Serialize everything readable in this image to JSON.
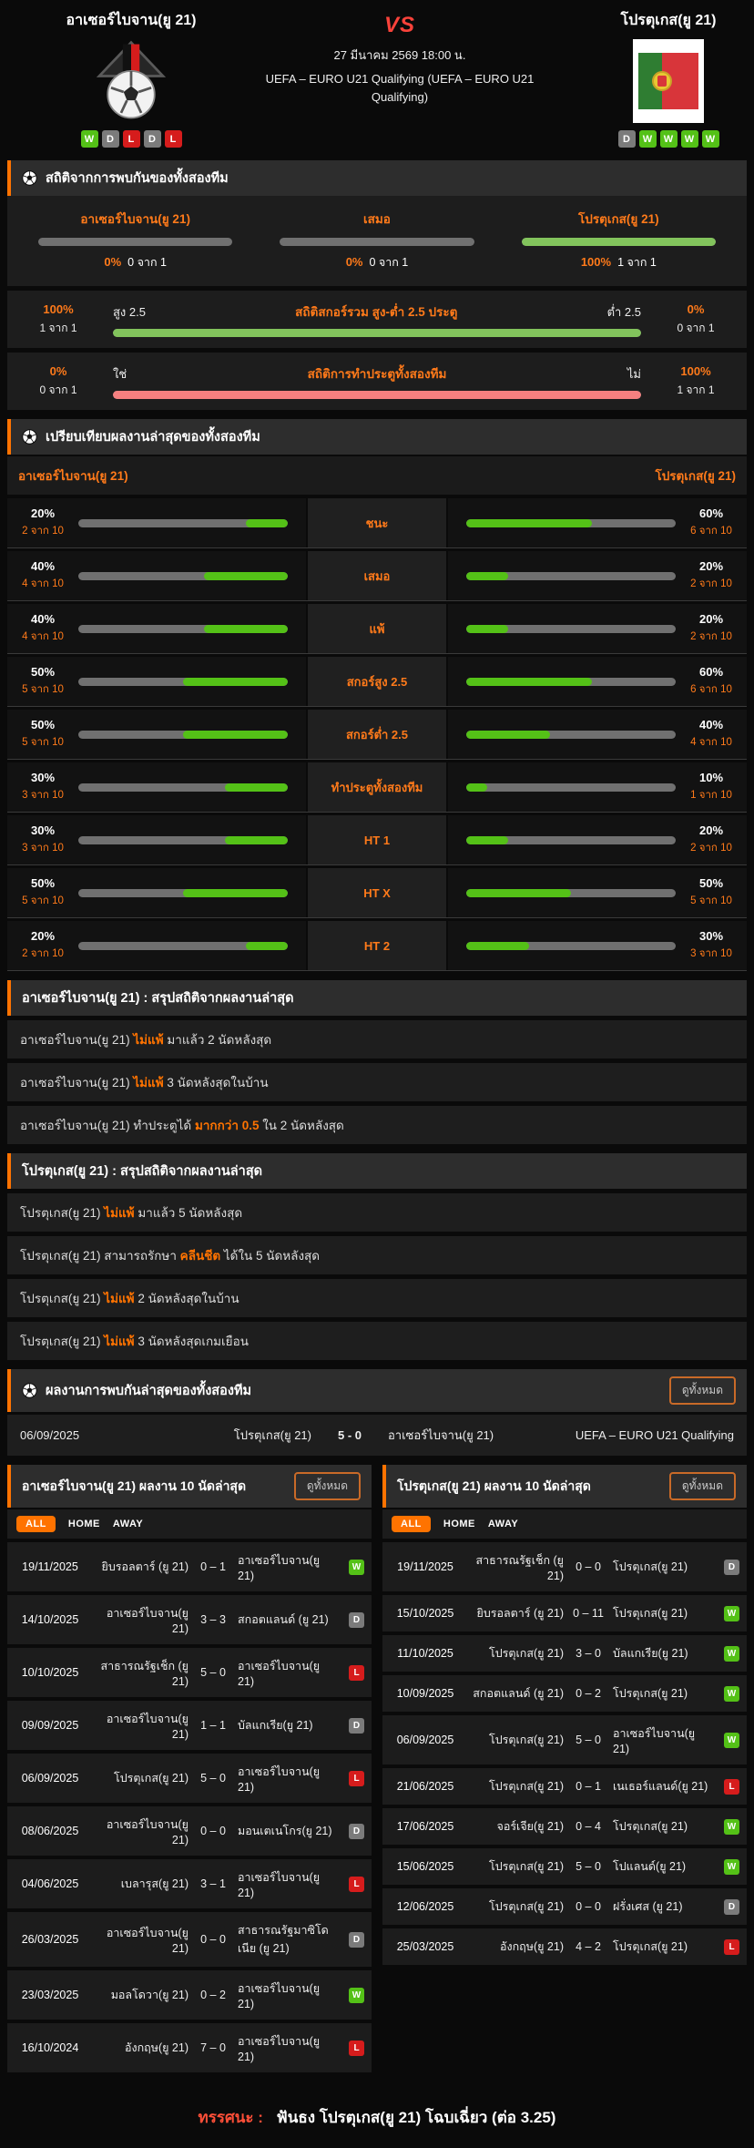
{
  "header": {
    "home": {
      "name": "อาเซอร์ไบจาน(ยู 21)",
      "form": [
        "W",
        "D",
        "L",
        "D",
        "L"
      ]
    },
    "away": {
      "name": "โปรตุเกส(ยู 21)",
      "form": [
        "D",
        "W",
        "W",
        "W",
        "W"
      ]
    },
    "vs": "VS",
    "datetime": "27 มีนาคม 2569 18:00 น.",
    "competition": "UEFA – EURO U21 Qualifying (UEFA – EURO U21 Qualifying)"
  },
  "h2h_stats": {
    "title": "สถิติจากการพบกันของทั้งสองทีม",
    "result_cols": [
      {
        "label": "อาเซอร์ไบจาน(ยู 21)",
        "pct": "0%",
        "count": "0 จาก 1",
        "fill": 0,
        "color": "green-soft"
      },
      {
        "label": "เสมอ",
        "pct": "0%",
        "count": "0 จาก 1",
        "fill": 0,
        "color": "green-soft"
      },
      {
        "label": "โปรตุเกส(ยู 21)",
        "pct": "100%",
        "count": "1 จาก 1",
        "fill": 100,
        "color": "green-soft"
      }
    ],
    "lines": [
      {
        "left_pct": "100%",
        "left_count": "1 จาก 1",
        "left_label": "สูง 2.5",
        "title": "สถิติสกอร์รวม สูง-ต่ำ 2.5 ประตู",
        "right_label": "ต่ำ 2.5",
        "right_pct": "0%",
        "right_count": "0 จาก 1",
        "fill": 100,
        "color": "green-soft"
      },
      {
        "left_pct": "0%",
        "left_count": "0 จาก 1",
        "left_label": "ใช่",
        "title": "สถิติการทำประตูทั้งสองทีม",
        "right_label": "ไม่",
        "right_pct": "100%",
        "right_count": "1 จาก 1",
        "fill": 100,
        "color": "pink"
      }
    ]
  },
  "comparison": {
    "title": "เปรียบเทียบผลงานล่าสุดของทั้งสองทีม",
    "home_team": "อาเซอร์ไบจาน(ยู 21)",
    "away_team": "โปรตุเกส(ยู 21)",
    "rows": [
      {
        "label": "ชนะ",
        "home_pct": 20,
        "home_count": "2 จาก 10",
        "away_pct": 60,
        "away_count": "6 จาก 10"
      },
      {
        "label": "เสมอ",
        "home_pct": 40,
        "home_count": "4 จาก 10",
        "away_pct": 20,
        "away_count": "2 จาก 10"
      },
      {
        "label": "แพ้",
        "home_pct": 40,
        "home_count": "4 จาก 10",
        "away_pct": 20,
        "away_count": "2 จาก 10"
      },
      {
        "label": "สกอร์สูง 2.5",
        "home_pct": 50,
        "home_count": "5 จาก 10",
        "away_pct": 60,
        "away_count": "6 จาก 10"
      },
      {
        "label": "สกอร์ต่ำ 2.5",
        "home_pct": 50,
        "home_count": "5 จาก 10",
        "away_pct": 40,
        "away_count": "4 จาก 10"
      },
      {
        "label": "ทำประตูทั้งสองทีม",
        "home_pct": 30,
        "home_count": "3 จาก 10",
        "away_pct": 10,
        "away_count": "1 จาก 10"
      },
      {
        "label": "HT 1",
        "home_pct": 30,
        "home_count": "3 จาก 10",
        "away_pct": 20,
        "away_count": "2 จาก 10"
      },
      {
        "label": "HT X",
        "home_pct": 50,
        "home_count": "5 จาก 10",
        "away_pct": 50,
        "away_count": "5 จาก 10"
      },
      {
        "label": "HT 2",
        "home_pct": 20,
        "home_count": "2 จาก 10",
        "away_pct": 30,
        "away_count": "3 จาก 10"
      }
    ]
  },
  "summaries": [
    {
      "title": "อาเซอร์ไบจาน(ยู 21) : สรุปสถิติจากผลงานล่าสุด",
      "rows": [
        {
          "pre": "อาเซอร์ไบจาน(ยู 21) ",
          "highlight": "ไม่แพ้",
          "post": " มาแล้ว 2 นัดหลังสุด"
        },
        {
          "pre": "อาเซอร์ไบจาน(ยู 21) ",
          "highlight": "ไม่แพ้",
          "post": " 3 นัดหลังสุดในบ้าน"
        },
        {
          "pre": "อาเซอร์ไบจาน(ยู 21) ทำประตูได้ ",
          "highlight": "มากกว่า 0.5",
          "post": " ใน 2 นัดหลังสุด"
        }
      ]
    },
    {
      "title": "โปรตุเกส(ยู 21) : สรุปสถิติจากผลงานล่าสุด",
      "rows": [
        {
          "pre": "โปรตุเกส(ยู 21) ",
          "highlight": "ไม่แพ้",
          "post": " มาแล้ว 5 นัดหลังสุด"
        },
        {
          "pre": "โปรตุเกส(ยู 21) สามารถรักษา ",
          "highlight": "คลีนชีต",
          "post": " ได้ใน 5 นัดหลังสุด"
        },
        {
          "pre": "โปรตุเกส(ยู 21) ",
          "highlight": "ไม่แพ้",
          "post": " 2 นัดหลังสุดในบ้าน"
        },
        {
          "pre": "โปรตุเกส(ยู 21) ",
          "highlight": "ไม่แพ้",
          "post": " 3 นัดหลังสุดเกมเยือน"
        }
      ]
    }
  ],
  "h2h_results": {
    "title": "ผลงานการพบกันล่าสุดของทั้งสองทีม",
    "view_all": "ดูทั้งหมด",
    "rows": [
      {
        "date": "06/09/2025",
        "home": "โปรตุเกส(ยู 21)",
        "score": "5 - 0",
        "away": "อาเซอร์ไบจาน(ยู 21)",
        "competition": "UEFA – EURO U21 Qualifying"
      }
    ]
  },
  "recent_tables": [
    {
      "title": "อาเซอร์ไบจาน(ยู 21) ผลงาน 10 นัดล่าสุด",
      "view_all": "ดูทั้งหมด",
      "tabs": [
        "ALL",
        "HOME",
        "AWAY"
      ],
      "active_tab": "ALL",
      "rows": [
        {
          "date": "19/11/2025",
          "home": "ยิบรอลตาร์ (ยู 21)",
          "score": "0 – 1",
          "away": "อาเซอร์ไบจาน(ยู 21)",
          "result": "W"
        },
        {
          "date": "14/10/2025",
          "home": "อาเซอร์ไบจาน(ยู 21)",
          "score": "3 – 3",
          "away": "สกอตแลนด์ (ยู 21)",
          "result": "D"
        },
        {
          "date": "10/10/2025",
          "home": "สาธารณรัฐเช็ก (ยู 21)",
          "score": "5 – 0",
          "away": "อาเซอร์ไบจาน(ยู 21)",
          "result": "L"
        },
        {
          "date": "09/09/2025",
          "home": "อาเซอร์ไบจาน(ยู 21)",
          "score": "1 – 1",
          "away": "บัลแกเรีย(ยู 21)",
          "result": "D"
        },
        {
          "date": "06/09/2025",
          "home": "โปรตุเกส(ยู 21)",
          "score": "5 – 0",
          "away": "อาเซอร์ไบจาน(ยู 21)",
          "result": "L"
        },
        {
          "date": "08/06/2025",
          "home": "อาเซอร์ไบจาน(ยู 21)",
          "score": "0 – 0",
          "away": "มอนเตเนโกร(ยู 21)",
          "result": "D"
        },
        {
          "date": "04/06/2025",
          "home": "เบลารุส(ยู 21)",
          "score": "3 – 1",
          "away": "อาเซอร์ไบจาน(ยู 21)",
          "result": "L"
        },
        {
          "date": "26/03/2025",
          "home": "อาเซอร์ไบจาน(ยู 21)",
          "score": "0 – 0",
          "away": "สาธารณรัฐมาซิโดเนีย (ยู 21)",
          "result": "D"
        },
        {
          "date": "23/03/2025",
          "home": "มอลโดวา(ยู 21)",
          "score": "0 – 2",
          "away": "อาเซอร์ไบจาน(ยู 21)",
          "result": "W"
        },
        {
          "date": "16/10/2024",
          "home": "อังกฤษ(ยู 21)",
          "score": "7 – 0",
          "away": "อาเซอร์ไบจาน(ยู 21)",
          "result": "L"
        }
      ]
    },
    {
      "title": "โปรตุเกส(ยู 21) ผลงาน 10 นัดล่าสุด",
      "view_all": "ดูทั้งหมด",
      "tabs": [
        "ALL",
        "HOME",
        "AWAY"
      ],
      "active_tab": "ALL",
      "rows": [
        {
          "date": "19/11/2025",
          "home": "สาธารณรัฐเช็ก (ยู 21)",
          "score": "0 – 0",
          "away": "โปรตุเกส(ยู 21)",
          "result": "D"
        },
        {
          "date": "15/10/2025",
          "home": "ยิบรอลตาร์ (ยู 21)",
          "score": "0 – 11",
          "away": "โปรตุเกส(ยู 21)",
          "result": "W"
        },
        {
          "date": "11/10/2025",
          "home": "โปรตุเกส(ยู 21)",
          "score": "3 – 0",
          "away": "บัลแกเรีย(ยู 21)",
          "result": "W"
        },
        {
          "date": "10/09/2025",
          "home": "สกอตแลนด์ (ยู 21)",
          "score": "0 – 2",
          "away": "โปรตุเกส(ยู 21)",
          "result": "W"
        },
        {
          "date": "06/09/2025",
          "home": "โปรตุเกส(ยู 21)",
          "score": "5 – 0",
          "away": "อาเซอร์ไบจาน(ยู 21)",
          "result": "W"
        },
        {
          "date": "21/06/2025",
          "home": "โปรตุเกส(ยู 21)",
          "score": "0 – 1",
          "away": "เนเธอร์แลนด์(ยู 21)",
          "result": "L"
        },
        {
          "date": "17/06/2025",
          "home": "จอร์เจีย(ยู 21)",
          "score": "0 – 4",
          "away": "โปรตุเกส(ยู 21)",
          "result": "W"
        },
        {
          "date": "15/06/2025",
          "home": "โปรตุเกส(ยู 21)",
          "score": "5 – 0",
          "away": "โปแลนด์(ยู 21)",
          "result": "W"
        },
        {
          "date": "12/06/2025",
          "home": "โปรตุเกส(ยู 21)",
          "score": "0 – 0",
          "away": "ฝรั่งเศส (ยู 21)",
          "result": "D"
        },
        {
          "date": "25/03/2025",
          "home": "อังกฤษ(ยู 21)",
          "score": "4 – 2",
          "away": "โปรตุเกส(ยู 21)",
          "result": "L"
        }
      ]
    }
  ],
  "footer": {
    "label": "ทรรศนะ :",
    "text": "ฟันธง โปรตุเกส(ยู 21) โฉบเฉี่ยว (ต่อ 3.25)"
  },
  "colors": {
    "accent": "#ff7a1a",
    "win": "#54c117",
    "draw": "#7b7b7b",
    "lose": "#d61c1c",
    "green_soft": "#82c35c",
    "pink": "#f58080",
    "vs_red": "#f9423a"
  }
}
